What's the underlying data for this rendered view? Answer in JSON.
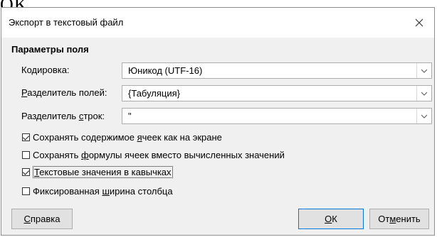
{
  "background_fragment": "OK",
  "dialog": {
    "title": "Экспорт в текстовый файл",
    "section_title": "Параметры поля"
  },
  "fields": {
    "encoding": {
      "label": "Кодировка:",
      "value": "Юникод (UTF-16)"
    },
    "field_separator": {
      "label_pre": "",
      "label_u": "Р",
      "label_post": "азделитель полей:",
      "value": "{Табуляция}"
    },
    "row_separator": {
      "label_pre": "Разделитель ",
      "label_u": "с",
      "label_post": "трок:",
      "value": "\""
    }
  },
  "options": [
    {
      "pre": "Сохранять содержимое ",
      "u": "я",
      "post": "чеек как на экране",
      "checked": true
    },
    {
      "pre": "Сохранять ",
      "u": "ф",
      "post": "ормулы ячеек вместо вычисленных значений",
      "checked": false
    },
    {
      "pre": "",
      "u": "Т",
      "post": "екстовые значения в кавычках",
      "checked": true
    },
    {
      "pre": "Фиксированная ",
      "u": "ш",
      "post": "ирина столбца",
      "checked": false
    }
  ],
  "buttons": {
    "help": {
      "pre": "",
      "u": "С",
      "post": "правка"
    },
    "ok": {
      "pre": "",
      "u": "О",
      "post": "К"
    },
    "cancel": {
      "pre": "От",
      "u": "м",
      "post": "енить"
    }
  },
  "icons": {
    "close": "close-icon",
    "dropdown": "chevron-down-icon"
  }
}
